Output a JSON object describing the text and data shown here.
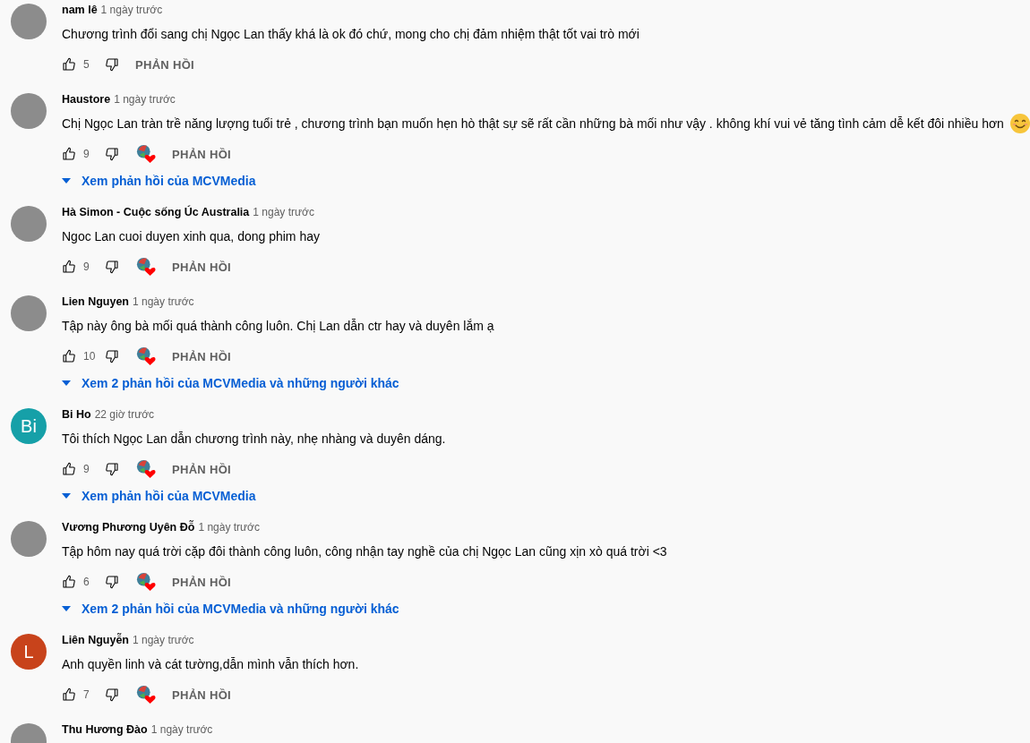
{
  "comments": [
    {
      "author": "nam lê",
      "time": "1 ngày trước",
      "avatar": {
        "kind": "photo"
      },
      "text": "Chương trình đổi sang chị Ngọc Lan thấy khá là ok đó chứ, mong cho chị đảm nhiệm thật tốt vai trò mới",
      "smiley": false,
      "likes": "5",
      "creator_heart": false,
      "reply_label": "PHẢN HỒI"
    },
    {
      "author": "Haustore",
      "time": "1 ngày trước",
      "avatar": {
        "kind": "photo"
      },
      "text": "Chị Ngọc Lan tràn trề năng lượng tuổi trẻ , chương trình bạn muốn hẹn hò thật sự sẽ rất cần những bà mối như vậy . không khí vui vẻ tăng tình cảm dễ kết đôi nhiều hơn",
      "smiley": true,
      "likes": "9",
      "creator_heart": true,
      "reply_label": "PHẢN HỒI",
      "replies": "Xem phản hồi của MCVMedia"
    },
    {
      "author": "Hà Simon - Cuộc sống Úc Australia",
      "time": "1 ngày trước",
      "avatar": {
        "kind": "photo"
      },
      "text": "Ngoc Lan cuoi duyen xinh qua, dong phim hay",
      "smiley": false,
      "likes": "9",
      "creator_heart": true,
      "reply_label": "PHẢN HỒI"
    },
    {
      "author": "Lien Nguyen",
      "time": "1 ngày trước",
      "avatar": {
        "kind": "photo"
      },
      "text": "Tập này ông bà mối quá thành công luôn. Chị Lan dẫn ctr hay và duyên lắm ạ",
      "smiley": false,
      "likes": "10",
      "creator_heart": true,
      "reply_label": "PHẢN HỒI",
      "replies": "Xem 2 phản hồi của MCVMedia và những người khác"
    },
    {
      "author": "Bi Ho",
      "time": "22 giờ trước",
      "avatar": {
        "kind": "letter",
        "letter": "Bi",
        "color": "#16a0a8"
      },
      "text": "Tôi thích Ngọc Lan dẫn chương trình này, nhẹ nhàng và duyên dáng.",
      "smiley": false,
      "likes": "9",
      "creator_heart": true,
      "reply_label": "PHẢN HỒI",
      "replies": "Xem phản hồi của MCVMedia"
    },
    {
      "author": "Vương Phương Uyên Đỗ",
      "time": "1 ngày trước",
      "avatar": {
        "kind": "photo"
      },
      "text": "Tập hôm nay quá trời cặp đôi thành công luôn, công nhận tay nghề của chị Ngọc Lan cũng xịn xò quá trời <3",
      "smiley": false,
      "likes": "6",
      "creator_heart": true,
      "reply_label": "PHẢN HỒI",
      "replies": "Xem 2 phản hồi của MCVMedia và những người khác"
    },
    {
      "author": "Liên Nguyễn",
      "time": "1 ngày trước",
      "avatar": {
        "kind": "letter",
        "letter": "L",
        "color": "#c8431b"
      },
      "text": "Anh quyền linh và cát tường,dẫn mình vẫn thích hơn.",
      "smiley": false,
      "likes": "7",
      "creator_heart": true,
      "reply_label": "PHẢN HỒI"
    },
    {
      "author": "Thu Hương Đào",
      "time": "1 ngày trước",
      "avatar": {
        "kind": "photo"
      }
    }
  ]
}
